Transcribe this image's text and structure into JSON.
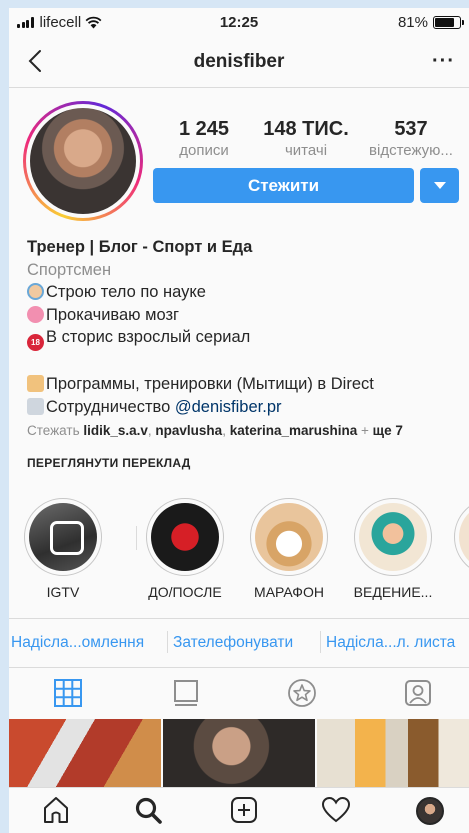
{
  "status_bar": {
    "carrier": "lifecell",
    "time": "12:25",
    "battery": "81%",
    "battery_level": 0.81
  },
  "nav": {
    "title": "denisfiber"
  },
  "stats": [
    {
      "value": "1 245",
      "label": "дописи"
    },
    {
      "value": "148 ТИС.",
      "label": "читачі"
    },
    {
      "value": "537",
      "label": "відстежую..."
    }
  ],
  "follow_label": "Стежити",
  "bio": {
    "name": "Тренер | Блог - Спорт и Еда",
    "category": "Спортсмен",
    "line1": "Строю тело по науке",
    "line2": "Прокачиваю мозг",
    "line3": "В сторис взрослый сериал",
    "line4": "Программы, тренировки (Мытищи) в Direct",
    "line5_prefix": "Сотрудничество ",
    "line5_link": "@denisfiber.pr"
  },
  "followed_by": {
    "prefix": "Стежать ",
    "user1": "lidik_s.a.v",
    "sep1": ", ",
    "user2": "npavlusha",
    "sep2": ", ",
    "user3": "katerina_marushina",
    "suffix_plus": " + ",
    "more": "ще 7"
  },
  "translate_label": "ПЕРЕГЛЯНУТИ ПЕРЕКЛАД",
  "highlights": [
    {
      "label": "IGTV"
    },
    {
      "label": "ДО/ПОСЛЕ"
    },
    {
      "label": "МАРАФОН"
    },
    {
      "label": "ВЕДЕНИЕ..."
    }
  ],
  "actions": [
    {
      "label": "Надісла...омлення"
    },
    {
      "label": "Зателефонувати"
    },
    {
      "label": "Надісла...л. листа"
    }
  ],
  "icons": {
    "back": "chevron-left-icon",
    "more": "ellipsis-icon",
    "grid": "grid-icon",
    "feed": "feed-icon",
    "igtv": "igtv-icon",
    "tagged": "tagged-icon",
    "home": "home-icon",
    "search": "search-icon",
    "new_post": "add-post-icon",
    "activity": "heart-icon"
  },
  "colors": {
    "accent": "#3897f0",
    "text": "#262626",
    "muted": "#8e8e8e"
  }
}
